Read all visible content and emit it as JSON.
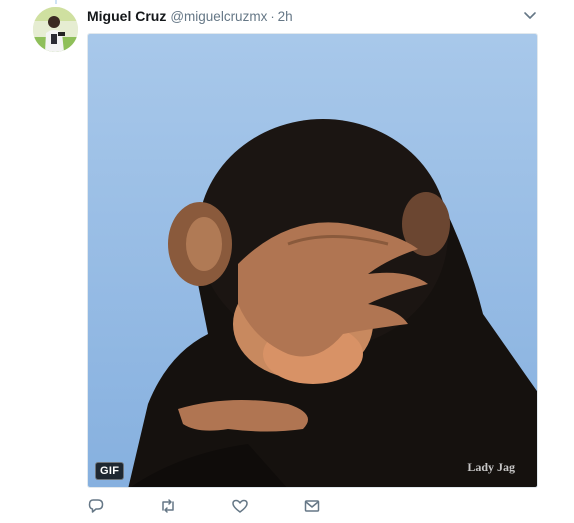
{
  "tweet": {
    "author_name": "Miguel Cruz",
    "author_handle": "@miguelcruzmx",
    "separator": "·",
    "timestamp": "2h"
  },
  "media": {
    "badge": "GIF",
    "watermark": "Lady Jag"
  },
  "icons": {
    "caret": "chevron-down-icon",
    "reply": "reply-icon",
    "retweet": "retweet-icon",
    "like": "heart-icon",
    "message": "envelope-icon"
  },
  "colors": {
    "secondary_text": "#657786",
    "icon": "#657786",
    "sky": "#9ec2e8"
  }
}
